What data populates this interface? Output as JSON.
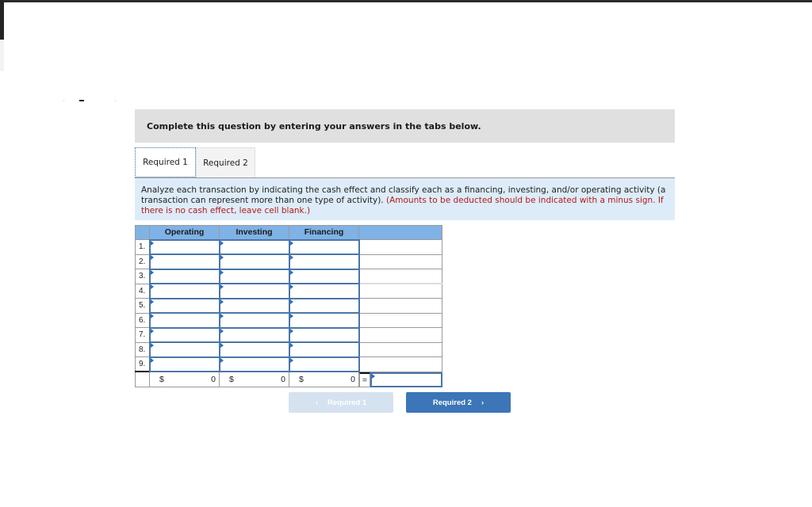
{
  "instruction": "Complete this question by entering your answers in the tabs below.",
  "tabs": [
    {
      "label": "Required 1",
      "active": true
    },
    {
      "label": "Required 2",
      "active": false
    }
  ],
  "question": {
    "text": "Analyze each transaction by indicating the cash effect and classify each as a financing, investing, and/or operating activity (a transaction can represent more than one type of activity).",
    "note": "(Amounts to be deducted should be indicated with a minus sign. If there is no cash effect, leave cell blank.)"
  },
  "table": {
    "headers": [
      "",
      "Operating",
      "Investing",
      "Financing",
      ""
    ],
    "rows": [
      "1.",
      "2.",
      "3.",
      "4.",
      "5.",
      "6.",
      "7.",
      "8.",
      "9."
    ],
    "totals": {
      "operating": {
        "currency": "$",
        "value": "0"
      },
      "investing": {
        "currency": "$",
        "value": "0"
      },
      "financing": {
        "currency": "$",
        "value": "0"
      },
      "equals": "=",
      "result": ""
    }
  },
  "nav": {
    "prev_label": "Required 1",
    "prev_icon": "‹",
    "next_label": "Required 2",
    "next_icon": "›"
  },
  "colors": {
    "header_bg": "#7fb2e5",
    "question_bg": "#ddecf8",
    "note_red": "#b31b1b",
    "next_btn": "#3c75b8",
    "prev_btn_disabled": "#d5e2f0"
  }
}
